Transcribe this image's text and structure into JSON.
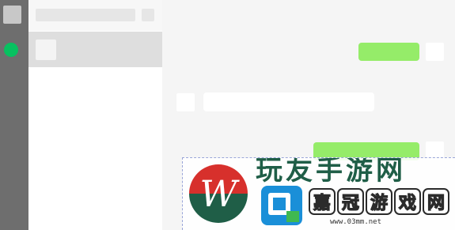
{
  "colors": {
    "nav_bg": "#6e6e6e",
    "online_dot": "#07c160",
    "outgoing_bubble": "#95ec69",
    "incoming_bubble": "#ffffff",
    "selected_item": "#dedede",
    "watermark_red": "#d7302c",
    "watermark_green": "#1f5e47",
    "watermark_blue": "#1a8fd8"
  },
  "nav": {
    "icons": [
      "avatar-icon",
      "chat-icon"
    ]
  },
  "watermark": {
    "top_text": "玩友手游网",
    "logo_letter": "W",
    "brand_chars": [
      "嘉",
      "冠",
      "游",
      "戏",
      "网"
    ],
    "url": "www.03mm.net"
  }
}
